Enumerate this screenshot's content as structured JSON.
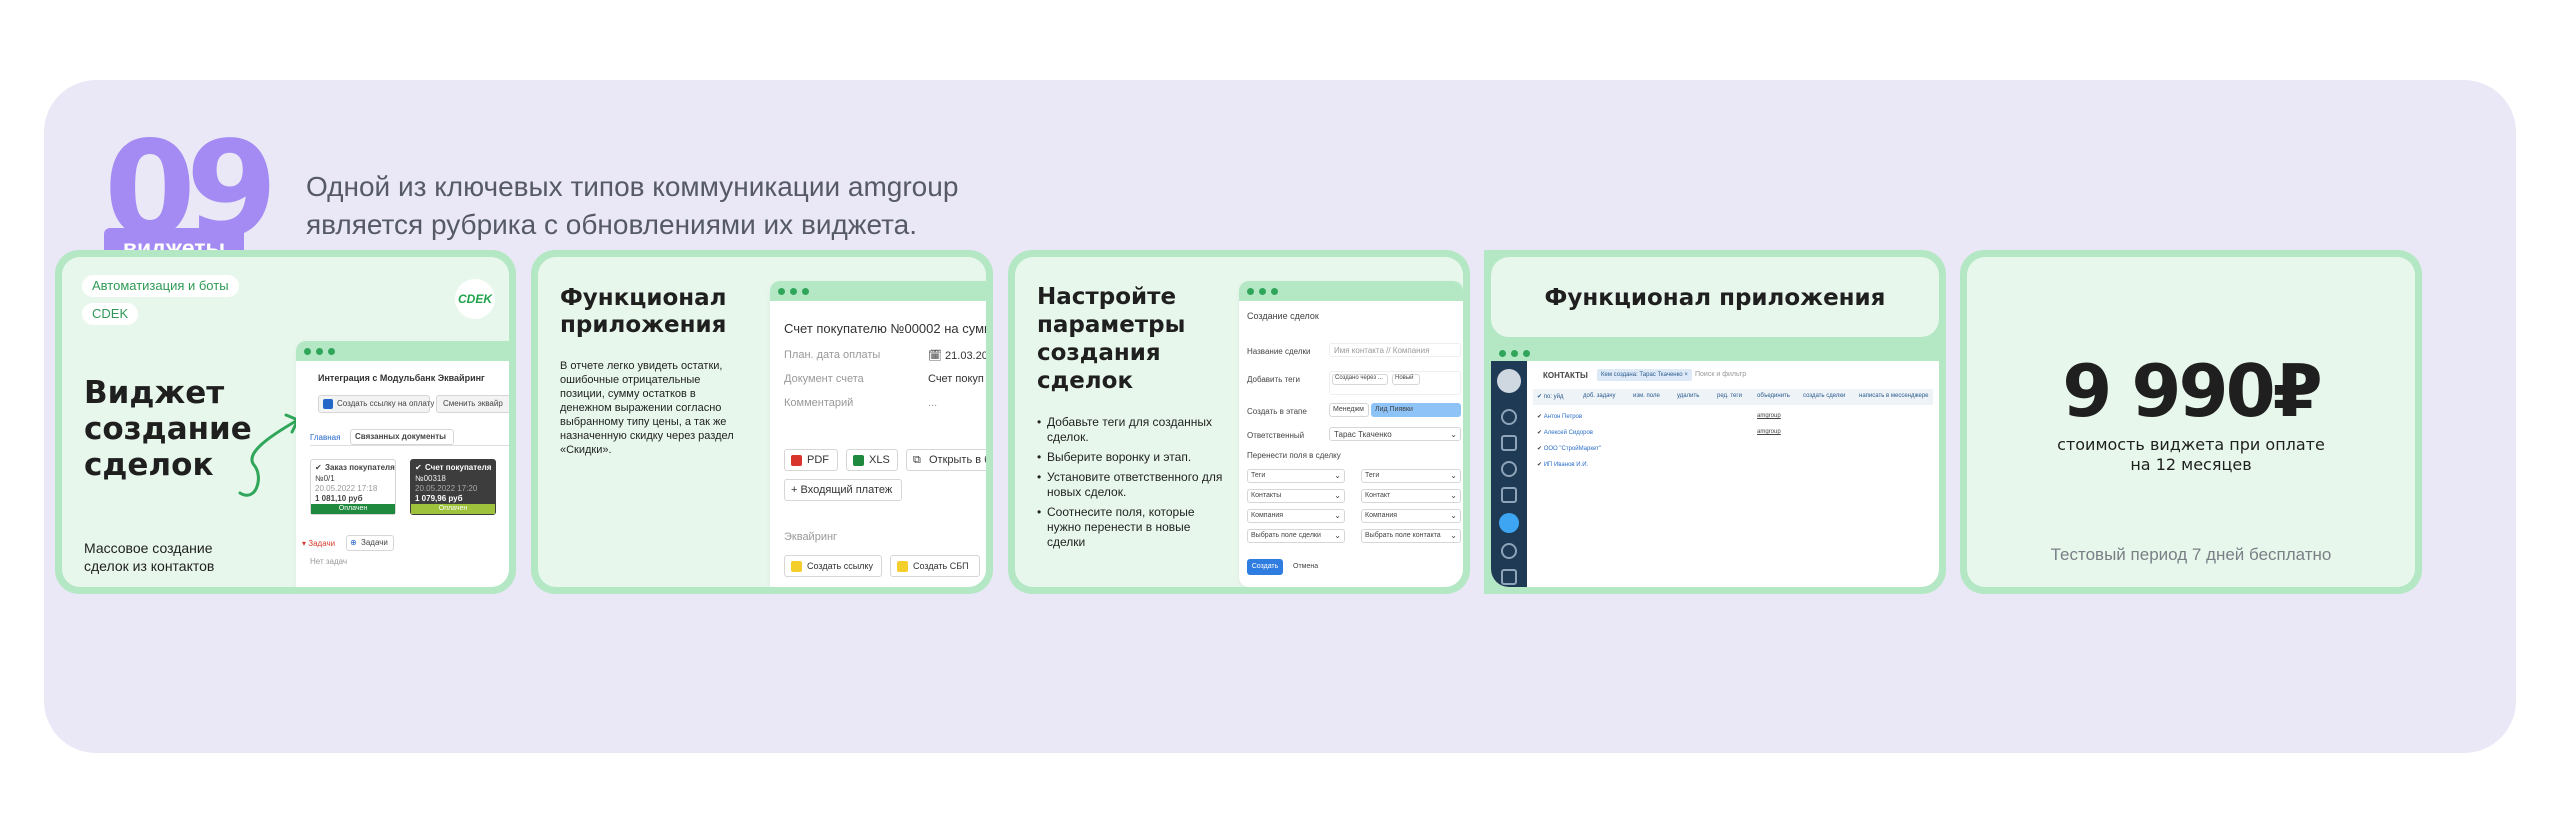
{
  "header": {
    "number": "09",
    "badge": "виджеты",
    "intro": "Одной из ключевых типов коммуникации amgroup является рубрика с обновлениями их виджета."
  },
  "colors": {
    "panel": "#eae8f6",
    "accent": "#a48bf3",
    "card_border": "#b4e7c4",
    "card_bg": "#e8f7ec",
    "green": "#2fa659"
  },
  "card1": {
    "chip1": "Автоматизация и боты",
    "chip2": "CDEK",
    "logo": "CDEK",
    "title1": "Виджет",
    "title2": "создание",
    "title3": "сделок",
    "desc1": "Массовое создание",
    "desc2": "сделок из контактов",
    "mock": {
      "title": "Интеграция с Модульбанк Эквайринг",
      "btn1": "Создать ссылку на оплату",
      "btn2": "Сменить эквайр",
      "tab1": "Главная",
      "tab2": "Связанных документы",
      "doc1_title": "Заказ покупателя",
      "doc1_num": "№0/1",
      "doc1_date": "20.05.2022 17:18",
      "doc1_sum": "1 081,10 руб",
      "doc1_status": "Оплачен",
      "doc2_title": "Счет покупателя",
      "doc2_num": "№00318",
      "doc2_date": "20.05.2022 17:20",
      "doc2_sum": "1 079,96 руб",
      "doc2_status": "Оплачен",
      "tasks": "Задачи",
      "tasks_btn": "Задачи",
      "no_tasks": "Нет задач"
    }
  },
  "card2": {
    "title1": "Функционал",
    "title2": "приложения",
    "desc": "В отчете легко увидеть остатки, ошибочные отрицательные позиции, сумму остатков в денежном выражении согласно выбранному типу цены, а так же назначенную скидку через раздел «Скидки».",
    "mock": {
      "title": "Счет покупателю №00002 на сумм",
      "row1_label": "План. дата оплаты",
      "row1_value": "21.03.20",
      "row2_label": "Документ счета",
      "row2_value": "Счет покуп",
      "row3_label": "Комментарий",
      "row3_value": "...",
      "btn_pdf": "PDF",
      "btn_xls": "XLS",
      "btn_open": "Открыть в б",
      "btn_payment": "+ Входящий платеж",
      "section": "Эквайринг",
      "btn_link": "Создать ссылку",
      "btn_sbp": "Создать СБП"
    }
  },
  "card3": {
    "title1": "Настройте",
    "title2": "параметры",
    "title3": "создания",
    "title4": "сделок",
    "bullets": [
      "Добавьте теги для созданных сделок.",
      "Выберите воронку и этап.",
      "Установите ответственного для новых сделок.",
      "Соотнесите поля, которые нужно перенести в новые сделки"
    ],
    "mock": {
      "title": "Создание сделок",
      "name_label": "Название сделки",
      "name_value": "Имя контакта // Компания",
      "tags_label": "Добавить теги",
      "tag1": "Создано через ...",
      "tag2": "Новый",
      "stage_label": "Создать в этапе",
      "stage1": "Менеджм",
      "stage2": "Лид Пиявки",
      "resp_label": "Ответственный",
      "resp_value": "Тарас Ткаченко",
      "transfer_label": "Перенести поля в сделку",
      "map_rows": [
        [
          "Теги",
          "Теги"
        ],
        [
          "Контакты",
          "Контакт"
        ],
        [
          "Компания",
          "Компания"
        ],
        [
          "Выбрать поле сделки",
          "Выбрать поле контакта"
        ]
      ],
      "create_btn": "Создать",
      "cancel_btn": "Отмена"
    }
  },
  "card4": {
    "title": "Функционал приложения",
    "mock": {
      "section": "КОНТАКТЫ",
      "filter": "Кем создана: Тарас Ткаченко",
      "search": "Поиск и фильтр",
      "toolbar": [
        "по: уйд",
        "доб. задачу",
        "изм. поле",
        "удалить",
        "ред. теги",
        "объединить",
        "создать сделки",
        "написать в мессенджере"
      ],
      "rows": [
        "Антон Петров",
        "Алексей Сидоров",
        "ООО \"СтройМаркет\"",
        "ИП Иванов И.И."
      ],
      "owner": "amgroup"
    }
  },
  "card5": {
    "price": "9 990₽",
    "caption1": "стоимость виджета при оплате",
    "caption2": "на 12 месяцев",
    "trial": "Тестовый период 7 дней бесплатно"
  }
}
